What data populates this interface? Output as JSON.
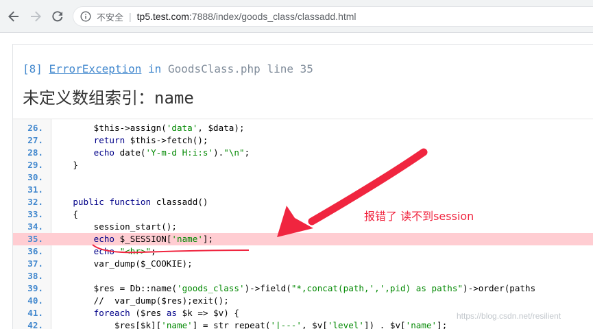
{
  "browser": {
    "insecure_label": "不安全",
    "separator": "|",
    "url_host": "tp5.test.com",
    "url_path": ":7888/index/goods_class/classadd.html"
  },
  "error": {
    "code": "[8]",
    "exception": "ErrorException",
    "in_text": "in",
    "file": "GoodsClass.php",
    "line_text": "line 35",
    "title_cn": "未定义数组索引：",
    "title_name": "name"
  },
  "code_lines": [
    {
      "no": "26.",
      "text": "        $this->assign('data', $data);"
    },
    {
      "no": "27.",
      "text": "        return $this->fetch();"
    },
    {
      "no": "28.",
      "text": "        echo date('Y-m-d H:i:s').\"\\n\";"
    },
    {
      "no": "29.",
      "text": "    }"
    },
    {
      "no": "30.",
      "text": ""
    },
    {
      "no": "31.",
      "text": ""
    },
    {
      "no": "32.",
      "text": "    public function classadd()"
    },
    {
      "no": "33.",
      "text": "    {"
    },
    {
      "no": "34.",
      "text": "        session_start();"
    },
    {
      "no": "35.",
      "text": "        echo $_SESSION['name'];"
    },
    {
      "no": "36.",
      "text": "        echo \"<hr>\";"
    },
    {
      "no": "37.",
      "text": "        var_dump($_COOKIE);"
    },
    {
      "no": "38.",
      "text": ""
    },
    {
      "no": "39.",
      "text": "        $res = Db::name('goods_class')->field(\"*,concat(path,',',pid) as paths\")->order('paths"
    },
    {
      "no": "40.",
      "text": "        //  var_dump($res);exit();"
    },
    {
      "no": "41.",
      "text": "        foreach ($res as $k => $v) {"
    },
    {
      "no": "42.",
      "text": "            $res[$k]['name'] = str_repeat('|---', $v['level']) . $v['name'];"
    }
  ],
  "highlight_line": "35.",
  "annotation": {
    "text": "报错了 读不到session",
    "color": "#f0253f"
  },
  "watermark": "https://blog.csdn.net/resilient",
  "colors": {
    "line_number": "#4288ce",
    "highlight": "#ffcdd2",
    "string": "#008800",
    "keyword": "#000088"
  },
  "icons": [
    "back-arrow-icon",
    "forward-arrow-icon",
    "reload-icon",
    "info-icon"
  ]
}
